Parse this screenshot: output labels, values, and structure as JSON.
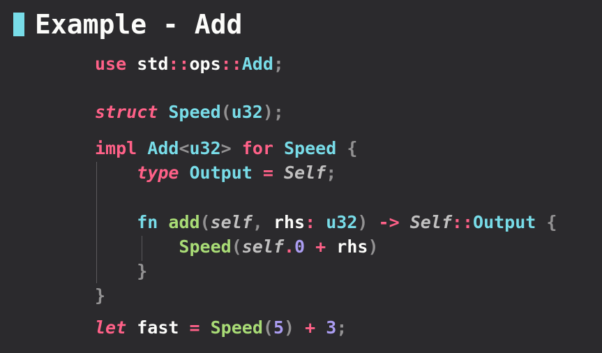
{
  "slide": {
    "title": "Example - Add",
    "accent_color": "#78dce8",
    "background_color": "#2b2a2d"
  },
  "code": {
    "language": "rust",
    "lines": [
      [
        {
          "t": "use",
          "c": "kw"
        },
        {
          "t": " ",
          "c": "plain"
        },
        {
          "t": "std",
          "c": "plain"
        },
        {
          "t": "::",
          "c": "op"
        },
        {
          "t": "ops",
          "c": "plain"
        },
        {
          "t": "::",
          "c": "op"
        },
        {
          "t": "Add",
          "c": "ty"
        },
        {
          "t": ";",
          "c": "pun"
        }
      ],
      [],
      [
        {
          "t": "struct",
          "c": "kw it"
        },
        {
          "t": " ",
          "c": "plain"
        },
        {
          "t": "Speed",
          "c": "ty"
        },
        {
          "t": "(",
          "c": "pun"
        },
        {
          "t": "u32",
          "c": "ty"
        },
        {
          "t": ")",
          "c": "pun"
        },
        {
          "t": ";",
          "c": "pun"
        }
      ],
      [
        {
          "t": "impl",
          "c": "kw"
        },
        {
          "t": " ",
          "c": "plain"
        },
        {
          "t": "Add",
          "c": "ty"
        },
        {
          "t": "<",
          "c": "pun"
        },
        {
          "t": "u32",
          "c": "ty"
        },
        {
          "t": ">",
          "c": "pun"
        },
        {
          "t": " ",
          "c": "plain"
        },
        {
          "t": "for",
          "c": "kw"
        },
        {
          "t": " ",
          "c": "plain"
        },
        {
          "t": "Speed",
          "c": "ty"
        },
        {
          "t": " ",
          "c": "plain"
        },
        {
          "t": "{",
          "c": "pun"
        }
      ],
      [
        {
          "t": "    ",
          "c": "plain"
        },
        {
          "t": "type",
          "c": "kw it"
        },
        {
          "t": " ",
          "c": "plain"
        },
        {
          "t": "Output",
          "c": "ty"
        },
        {
          "t": " ",
          "c": "plain"
        },
        {
          "t": "=",
          "c": "op"
        },
        {
          "t": " ",
          "c": "plain"
        },
        {
          "t": "Self",
          "c": "slf"
        },
        {
          "t": ";",
          "c": "pun"
        }
      ],
      [],
      [
        {
          "t": "    ",
          "c": "plain"
        },
        {
          "t": "fn",
          "c": "ty"
        },
        {
          "t": " ",
          "c": "plain"
        },
        {
          "t": "add",
          "c": "fn"
        },
        {
          "t": "(",
          "c": "pun"
        },
        {
          "t": "self",
          "c": "slf"
        },
        {
          "t": ",",
          "c": "pun"
        },
        {
          "t": " ",
          "c": "plain"
        },
        {
          "t": "rhs",
          "c": "plain"
        },
        {
          "t": ":",
          "c": "op"
        },
        {
          "t": " ",
          "c": "plain"
        },
        {
          "t": "u32",
          "c": "ty"
        },
        {
          "t": ")",
          "c": "pun"
        },
        {
          "t": " ",
          "c": "plain"
        },
        {
          "t": "->",
          "c": "op"
        },
        {
          "t": " ",
          "c": "plain"
        },
        {
          "t": "Self",
          "c": "slf"
        },
        {
          "t": "::",
          "c": "op"
        },
        {
          "t": "Output",
          "c": "ty"
        },
        {
          "t": " ",
          "c": "plain"
        },
        {
          "t": "{",
          "c": "pun"
        }
      ],
      [
        {
          "t": "        ",
          "c": "plain"
        },
        {
          "t": "Speed",
          "c": "fn"
        },
        {
          "t": "(",
          "c": "pun"
        },
        {
          "t": "self",
          "c": "slf"
        },
        {
          "t": ".",
          "c": "op"
        },
        {
          "t": "0",
          "c": "num"
        },
        {
          "t": " ",
          "c": "plain"
        },
        {
          "t": "+",
          "c": "op"
        },
        {
          "t": " ",
          "c": "plain"
        },
        {
          "t": "rhs",
          "c": "plain"
        },
        {
          "t": ")",
          "c": "pun"
        }
      ],
      [
        {
          "t": "    ",
          "c": "plain"
        },
        {
          "t": "}",
          "c": "pun"
        }
      ],
      [
        {
          "t": "}",
          "c": "pun"
        }
      ],
      [
        {
          "t": "let",
          "c": "kw it"
        },
        {
          "t": " ",
          "c": "plain"
        },
        {
          "t": "fast",
          "c": "plain"
        },
        {
          "t": " ",
          "c": "plain"
        },
        {
          "t": "=",
          "c": "op"
        },
        {
          "t": " ",
          "c": "plain"
        },
        {
          "t": "Speed",
          "c": "fn"
        },
        {
          "t": "(",
          "c": "pun"
        },
        {
          "t": "5",
          "c": "num"
        },
        {
          "t": ")",
          "c": "pun"
        },
        {
          "t": " ",
          "c": "plain"
        },
        {
          "t": "+",
          "c": "op"
        },
        {
          "t": " ",
          "c": "plain"
        },
        {
          "t": "3",
          "c": "num"
        },
        {
          "t": ";",
          "c": "pun"
        }
      ]
    ]
  }
}
